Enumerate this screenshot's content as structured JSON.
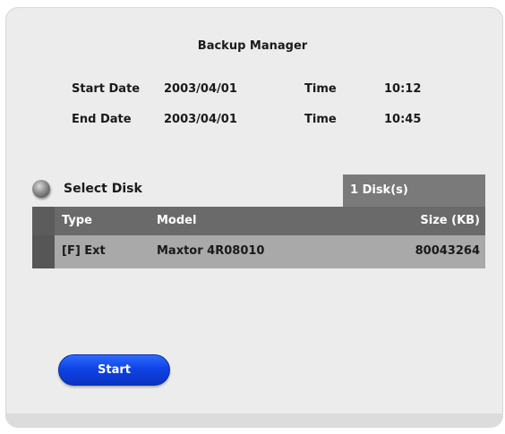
{
  "dialog": {
    "title": "Backup Manager"
  },
  "schedule": {
    "start": {
      "label": "Start Date",
      "date": "2003/04/01",
      "time_label": "Time",
      "time": "10:12"
    },
    "end": {
      "label": "End Date",
      "date": "2003/04/01",
      "time_label": "Time",
      "time": "10:45"
    }
  },
  "disk_select": {
    "label": "Select Disk",
    "count": "1 Disk(s)"
  },
  "disk_table": {
    "columns": [
      "Type",
      "Model",
      "Size (KB)"
    ],
    "rows": [
      {
        "type": "[F] Ext",
        "model": "Maxtor 4R08010",
        "size": "80043264"
      }
    ]
  },
  "actions": {
    "start_label": "Start"
  },
  "colors": {
    "panel": "#ececec",
    "table_header": "#6a6a6a",
    "table_row": "#a9a9a9",
    "button": "#0f43e6"
  }
}
